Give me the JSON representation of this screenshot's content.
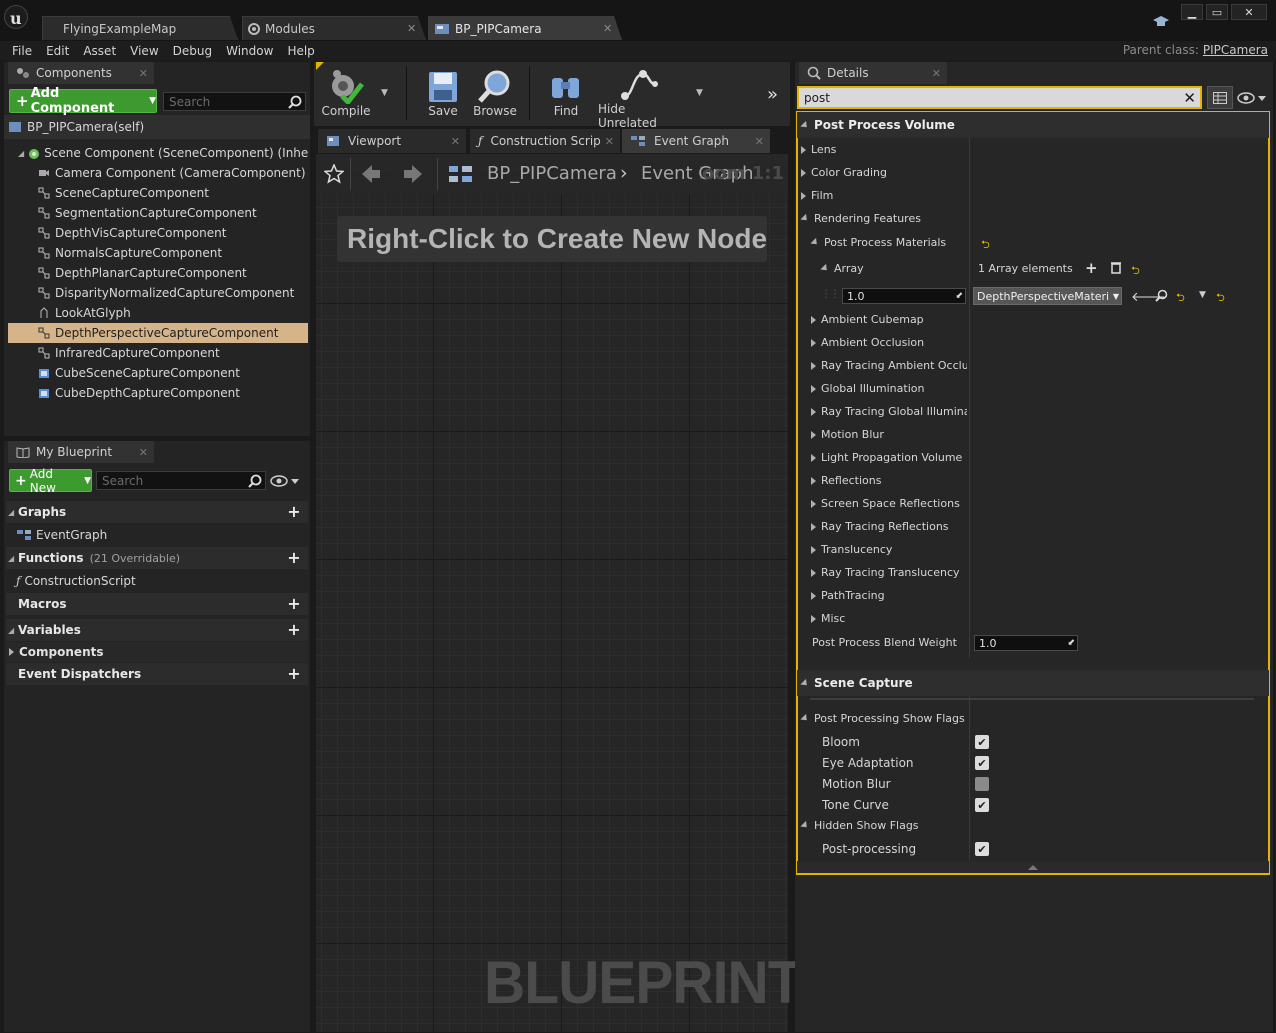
{
  "tabs": [
    "FlyingExampleMap",
    "Modules",
    "BP_PIPCamera"
  ],
  "menu": [
    "File",
    "Edit",
    "Asset",
    "View",
    "Debug",
    "Window",
    "Help"
  ],
  "parent_class": {
    "label": "Parent class:",
    "value": "PIPCamera"
  },
  "components": {
    "tab": "Components",
    "add_button": "Add Component",
    "search_placeholder": "Search",
    "self": "BP_PIPCamera(self)",
    "root": "Scene Component (SceneComponent) (Inherited)",
    "items": [
      "Camera Component (CameraComponent) (Inherited)",
      "SceneCaptureComponent",
      "SegmentationCaptureComponent",
      "DepthVisCaptureComponent",
      "NormalsCaptureComponent",
      "DepthPlanarCaptureComponent",
      "DisparityNormalizedCaptureComponent",
      "LookAtGlyph",
      "DepthPerspectiveCaptureComponent",
      "InfraredCaptureComponent",
      "CubeSceneCaptureComponent",
      "CubeDepthCaptureComponent"
    ],
    "selected": "DepthPerspectiveCaptureComponent"
  },
  "my_blueprint": {
    "tab": "My Blueprint",
    "add_button": "Add New",
    "search_placeholder": "Search",
    "sections": {
      "graphs": "Graphs",
      "event_graph": "EventGraph",
      "functions": "Functions",
      "functions_sub": "(21 Overridable)",
      "construction_script": "ConstructionScript",
      "macros": "Macros",
      "variables": "Variables",
      "components": "Components",
      "dispatchers": "Event Dispatchers"
    }
  },
  "toolbar": {
    "compile": "Compile",
    "save": "Save",
    "browse": "Browse",
    "find": "Find",
    "hide_unrelated": "Hide Unrelated"
  },
  "graph_tabs": [
    "Viewport",
    "Construction Scrip",
    "Event Graph"
  ],
  "graph": {
    "breadcrumb_bp": "BP_PIPCamera",
    "breadcrumb_graph": "Event Graph",
    "zoom": "Zoom 1:1",
    "hint": "Right-Click to Create New Nodes",
    "watermark": "BLUEPRINT"
  },
  "details": {
    "tab": "Details",
    "search_value": "post",
    "ppv_category": "Post Process Volume",
    "ppv_rows": {
      "lens": "Lens",
      "color_grading": "Color Grading",
      "film": "Film",
      "rendering_features": "Rendering Features",
      "post_process_materials": "Post Process Materials",
      "array": "Array",
      "array_count": "1 Array elements",
      "element_value": "1.0",
      "element_material": "DepthPerspectiveMaterial",
      "ambient_cubemap": "Ambient Cubemap",
      "ambient_occlusion": "Ambient Occlusion",
      "rt_ambient_occlusion": "Ray Tracing Ambient Occlusion",
      "global_illumination": "Global Illumination",
      "rt_global_illumination": "Ray Tracing Global Illumination",
      "motion_blur": "Motion Blur",
      "lpv": "Light Propagation Volume",
      "reflections": "Reflections",
      "ssr": "Screen Space Reflections",
      "rt_reflections": "Ray Tracing Reflections",
      "translucency": "Translucency",
      "rt_translucency": "Ray Tracing Translucency",
      "path_tracing": "PathTracing",
      "misc": "Misc",
      "blend_weight_label": "Post Process Blend Weight",
      "blend_weight_value": "1.0"
    },
    "scene_capture_category": "Scene Capture",
    "show_flags": {
      "group": "Post Processing Show Flags",
      "bloom": "Bloom",
      "bloom_checked": true,
      "eye_adaptation": "Eye Adaptation",
      "eye_adaptation_checked": true,
      "motion_blur": "Motion Blur",
      "motion_blur_checked": false,
      "tone_curve": "Tone Curve",
      "tone_curve_checked": true
    },
    "hidden_flags": {
      "group": "Hidden Show Flags",
      "post_processing": "Post-processing",
      "post_processing_checked": true
    }
  },
  "colors": {
    "accent_green": "#3c9a2f",
    "selection": "#d5b48a",
    "focus_outline": "#e2b400"
  }
}
